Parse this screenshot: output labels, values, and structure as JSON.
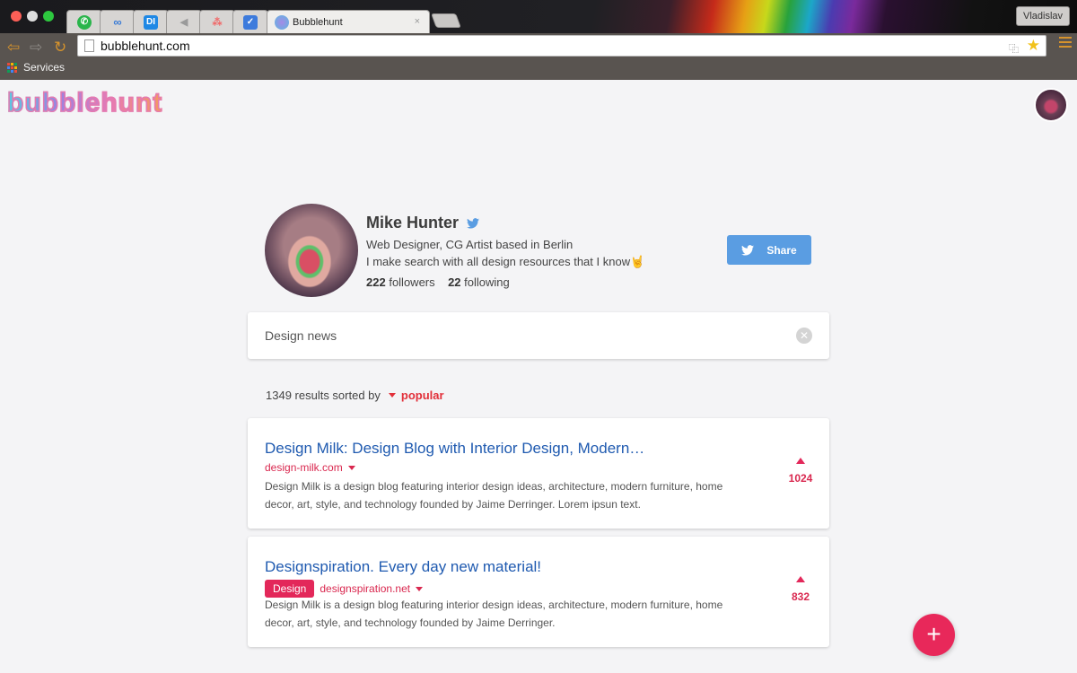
{
  "browser": {
    "tabs": [
      {
        "icon": "whatsapp-icon",
        "color": "#2ab54b"
      },
      {
        "icon": "link-icon",
        "color": "#3a7bd5"
      },
      {
        "icon": "db-icon",
        "color": "#1e88e5",
        "text": "DI"
      },
      {
        "icon": "speaker-icon",
        "color": "#9a9a9a"
      },
      {
        "icon": "asana-icon",
        "color": "#f06a6a"
      },
      {
        "icon": "mail-check-icon",
        "color": "#3d7bdc"
      }
    ],
    "active_tab_title": "Bubblehunt",
    "active_tab_close": "×",
    "user_name": "Vladislav",
    "url": "bubblehunt.com",
    "bookmarks_label": "Services"
  },
  "page": {
    "logo_text": "bubblehunt",
    "profile": {
      "name": "Mike Hunter",
      "bio_line1": "Web Designer, CG Artist based in Berlin",
      "bio_line2": "I make search with all design resources that I know🤘",
      "followers_count": "222",
      "followers_label": "followers",
      "following_count": "22",
      "following_label": "following",
      "share_label": "Share"
    },
    "search": {
      "query": "Design news"
    },
    "results": {
      "count_text": "1349 results sorted by",
      "sort_value": "popular",
      "items": [
        {
          "title": "Design Milk: Design Blog with Interior Design, Modern…",
          "domain": "design-milk.com",
          "description": "Design Milk is a design blog featuring interior design ideas, architecture, modern furniture, home decor, art, style, and technology founded by Jaime Derringer. Lorem ipsun text.",
          "votes": "1024"
        },
        {
          "title": "Designspiration. Every day new material!",
          "tag": "Design",
          "domain": "designspiration.net",
          "description": "Design Milk is a design blog featuring interior design ideas, architecture, modern furniture, home decor, art, style, and technology founded by Jaime Derringer.",
          "votes": "832"
        }
      ]
    },
    "fab_label": "+"
  },
  "colors": {
    "accent": "#e3285a",
    "link": "#1f5ab0",
    "twitter": "#5a9de2",
    "sort": "#e2303a"
  }
}
